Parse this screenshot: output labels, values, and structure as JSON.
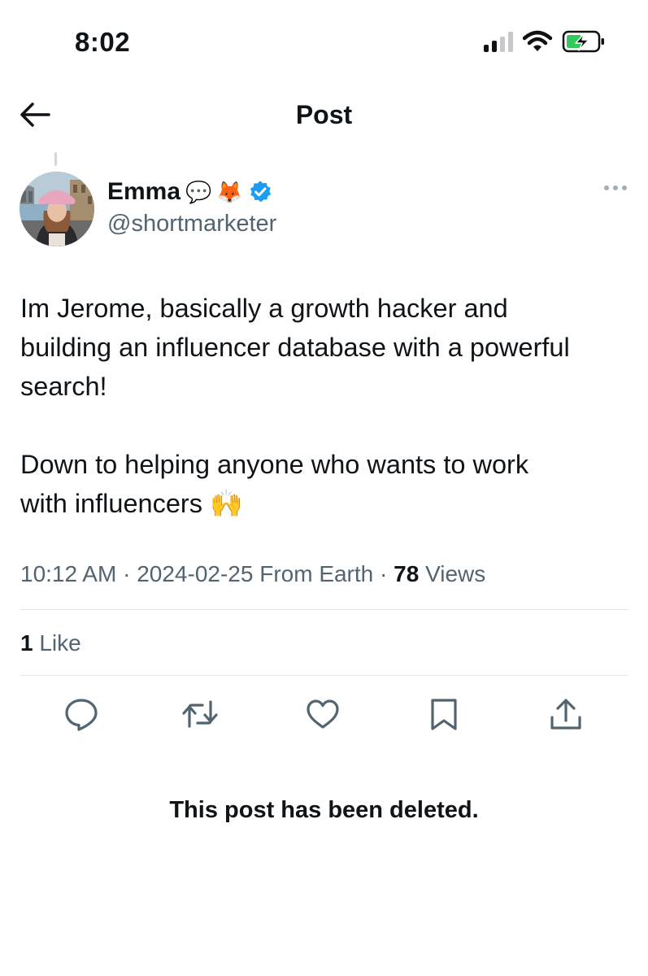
{
  "status_bar": {
    "time": "8:02"
  },
  "header": {
    "title": "Post"
  },
  "author": {
    "display_name": "Emma",
    "name_emojis": [
      "💬",
      "🦊"
    ],
    "handle": "@shortmarketer",
    "verified_color": "#1d9bf0"
  },
  "post": {
    "text": "Im Jerome, basically a growth hacker and\nbuilding an influencer database with a powerful\nsearch!\n\nDown to helping anyone who wants to work\nwith influencers 🙌",
    "time": "10:12 AM",
    "date": "2024-02-25 From Earth",
    "separator": "·",
    "views_count": "78",
    "views_label": "Views",
    "likes_count": "1",
    "likes_label": "Like"
  },
  "actions": [
    "reply-icon",
    "repost-icon",
    "like-icon",
    "bookmark-icon",
    "share-icon"
  ],
  "deleted_notice": "This post has been deleted."
}
